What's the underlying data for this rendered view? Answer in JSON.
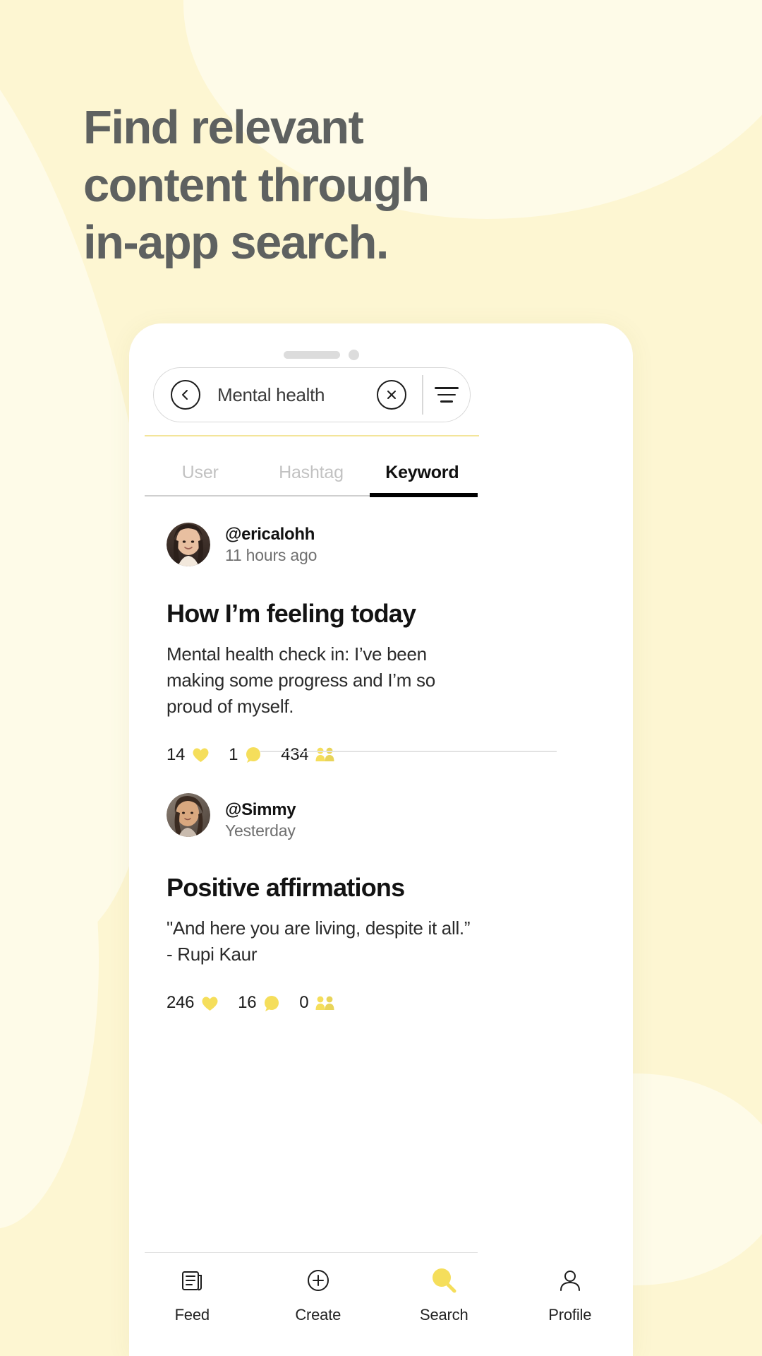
{
  "promo": {
    "headline_lines": [
      "Find relevant",
      "content through",
      "in-app search."
    ],
    "background_color": "#FDF6D2",
    "headline_color": "#5E6160"
  },
  "search": {
    "query": "Mental health",
    "back_icon": "chevron-left-icon",
    "clear_icon": "close-icon",
    "filter_icon": "filter-sort-icon"
  },
  "tabs": [
    {
      "label": "User",
      "active": false
    },
    {
      "label": "Hashtag",
      "active": false
    },
    {
      "label": "Keyword",
      "active": true
    }
  ],
  "posts": [
    {
      "handle": "@ericalohh",
      "timestamp": "11 hours ago",
      "title": "How I’m feeling today",
      "body_lines": [
        "Mental health check in: I’ve been",
        "making some progress and I’m so",
        "proud of myself."
      ],
      "stats": {
        "likes": "14",
        "comments": "1",
        "shares": "434"
      }
    },
    {
      "handle": "@Simmy",
      "timestamp": "Yesterday",
      "title": "Positive affirmations",
      "body_lines": [
        "\"And here you are living, despite it all.”",
        "- Rupi Kaur"
      ],
      "stats": {
        "likes": "246",
        "comments": "16",
        "shares": "0"
      }
    }
  ],
  "stat_icons": {
    "like": "heart-icon",
    "comment": "comment-icon",
    "share": "share-people-icon"
  },
  "bottom_nav": [
    {
      "label": "Feed",
      "icon": "feed-icon",
      "active": false
    },
    {
      "label": "Create",
      "icon": "plus-circle-icon",
      "active": false
    },
    {
      "label": "Search",
      "icon": "search-icon",
      "active": true
    },
    {
      "label": "Profile",
      "icon": "person-icon",
      "active": false
    }
  ],
  "colors": {
    "accent_yellow": "#F5DE5B",
    "rule_yellow": "#F3E59A",
    "active_tab": "#000000"
  }
}
